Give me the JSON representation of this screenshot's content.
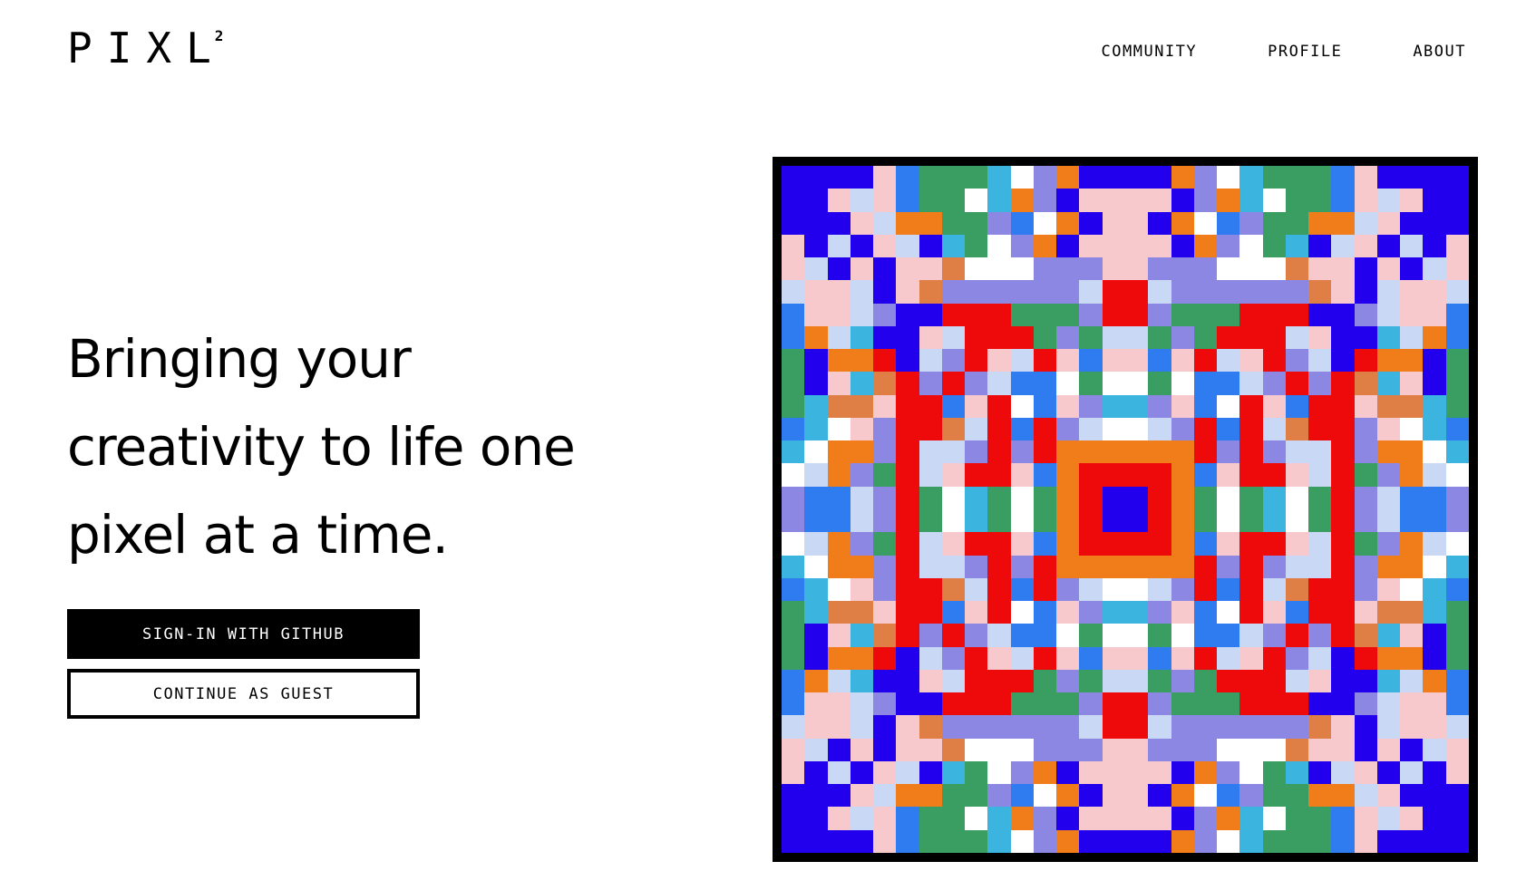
{
  "header": {
    "logo": {
      "text": "PIXL",
      "superscript": "2"
    },
    "nav": [
      {
        "label": "COMMUNITY"
      },
      {
        "label": "PROFILE"
      },
      {
        "label": "ABOUT"
      }
    ]
  },
  "hero": {
    "headline_lines": [
      "Bringing your",
      "creativity to life one",
      "pixel at a time."
    ],
    "primary_button": "SIGN-IN WITH GITHUB",
    "secondary_button": "CONTINUE AS GUEST"
  },
  "artwork": {
    "palette": {
      "B": "#2200ee",
      "p": "#f7c9cc",
      "s": "#c9d8f5",
      "o": "#f07d1a",
      "O": "#e07f45",
      "g": "#3a9e63",
      "c": "#3bb5e0",
      "b": "#2f7bf0",
      "v": "#8b87e2",
      "R": "#ee0a0a",
      "w": "#ffffff",
      "l": "#d8d8d8",
      "k": "#000000"
    }
  }
}
